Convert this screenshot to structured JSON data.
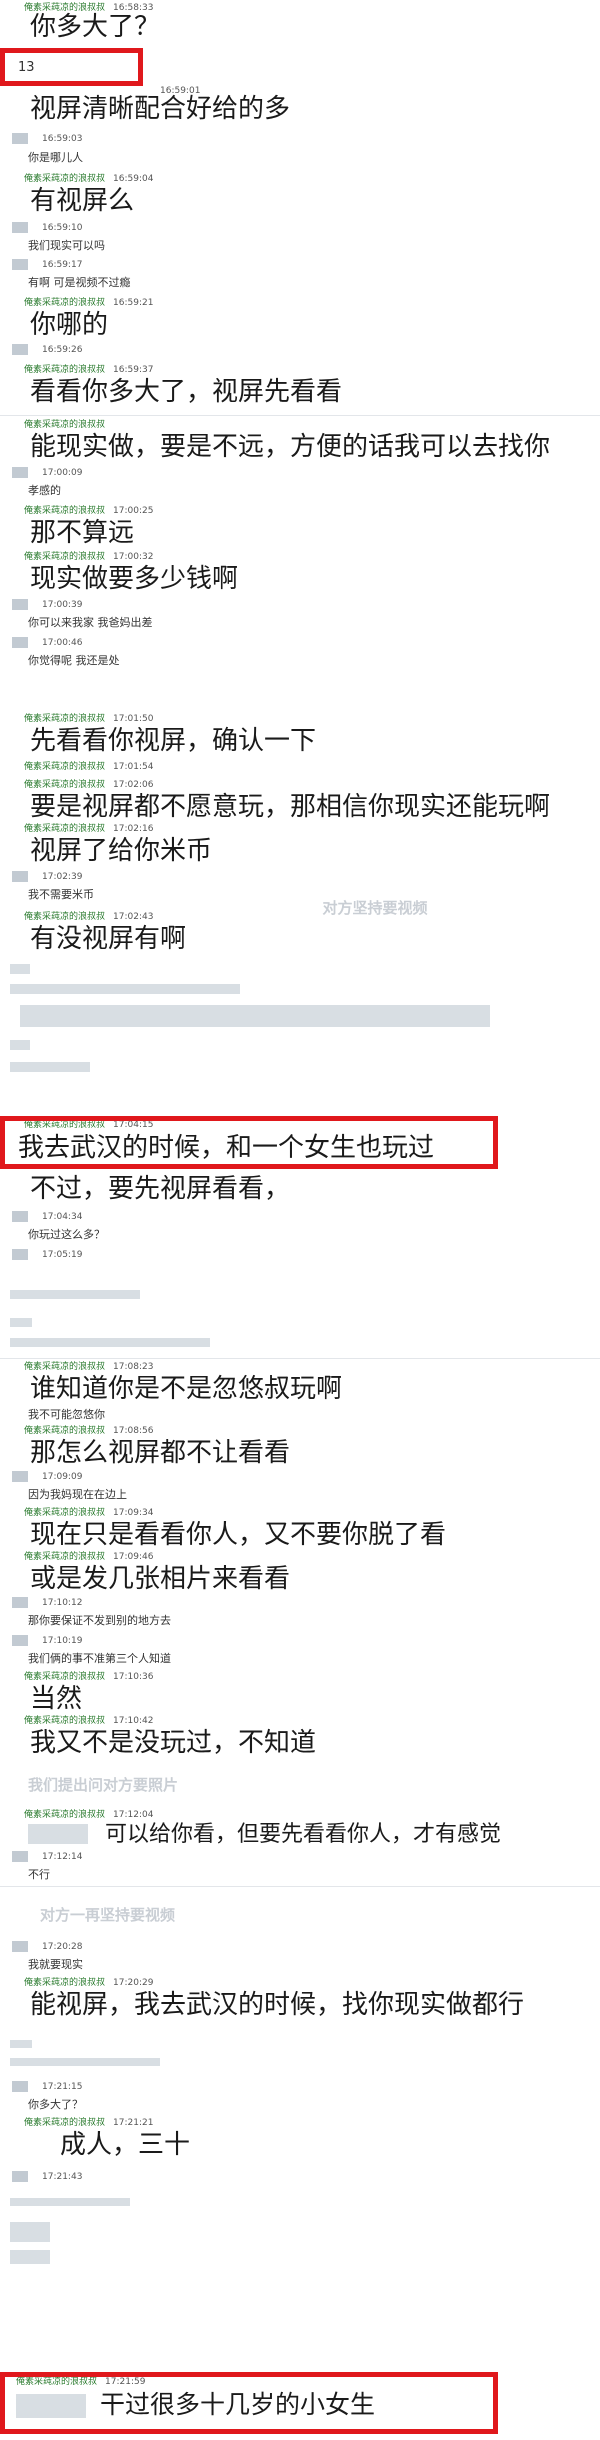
{
  "chat": {
    "sender_name": "俺素采莼凉的浪叔叔",
    "messages": [
      {
        "time": "16:58:33",
        "text": "你多大了？",
        "style": "big",
        "from": "other"
      },
      {
        "time": "",
        "text": "13",
        "style": "small",
        "from": "girl"
      },
      {
        "time": "16:59:01",
        "text": "视屏清晰配合好给的多",
        "style": "big",
        "from": "other"
      },
      {
        "time": "16:59:03",
        "text": "你是哪儿人",
        "style": "small",
        "from": "girl"
      },
      {
        "time": "16:59:04",
        "text": "有视屏么",
        "style": "big",
        "from": "other"
      },
      {
        "time": "16:59:10",
        "text": "我们现实可以吗",
        "style": "small",
        "from": "girl"
      },
      {
        "time": "16:59:17",
        "text": "有啊 可是视频不过瘾",
        "style": "small",
        "from": "girl"
      },
      {
        "time": "16:59:21",
        "text": "你哪的",
        "style": "big",
        "from": "other"
      },
      {
        "time": "16:59:26",
        "text": "",
        "style": "none",
        "from": "girl"
      },
      {
        "time": "16:59:37",
        "text": "看看你多大了，视屏先看看",
        "style": "big",
        "from": "other"
      },
      {
        "time": "",
        "text": "能现实做，要是不远，方便的话我可以去找你",
        "style": "big",
        "from": "other"
      },
      {
        "time": "17:00:09",
        "text": "孝感的",
        "style": "small",
        "from": "girl"
      },
      {
        "time": "17:00:25",
        "text": "那不算远",
        "style": "big",
        "from": "other"
      },
      {
        "time": "17:00:32",
        "text": "现实做要多少钱啊",
        "style": "big",
        "from": "other"
      },
      {
        "time": "17:00:39",
        "text": "你可以来我家 我爸妈出差",
        "style": "small",
        "from": "girl"
      },
      {
        "time": "17:00:46",
        "text": "你觉得呢 我还是处",
        "style": "small",
        "from": "girl"
      },
      {
        "time": "17:01:50",
        "text": "先看看你视屏，确认一下",
        "style": "big",
        "from": "other"
      },
      {
        "time": "17:01:54",
        "text": "",
        "style": "none",
        "from": "other"
      },
      {
        "time": "17:02:06",
        "text": "要是视屏都不愿意玩，那相信你现实还能玩啊",
        "style": "big",
        "from": "other"
      },
      {
        "time": "17:02:16",
        "text": "视屏了给你米币",
        "style": "big",
        "from": "other"
      },
      {
        "time": "17:02:39",
        "text": "我不需要米币",
        "style": "small",
        "from": "girl"
      },
      {
        "time": "17:02:43",
        "text": "有没视屏有啊",
        "style": "big",
        "from": "other"
      },
      {
        "time": "17:04:15",
        "text": "我去武汉的时候，和一个女生也玩过",
        "style": "big",
        "from": "other"
      },
      {
        "time": "",
        "text": "不过，要先视屏看看，",
        "style": "big",
        "from": "other"
      },
      {
        "time": "17:04:34",
        "text": "你玩过这么多？",
        "style": "small",
        "from": "girl"
      },
      {
        "time": "17:05:19",
        "text": "",
        "style": "none",
        "from": "girl"
      },
      {
        "time": "17:08:23",
        "text": "谁知道你是不是忽悠叔玩啊",
        "style": "big",
        "from": "other"
      },
      {
        "time": "",
        "text": "我不可能忽悠你",
        "style": "small",
        "from": "girl"
      },
      {
        "time": "17:08:56",
        "text": "那怎么视屏都不让看看",
        "style": "big",
        "from": "other"
      },
      {
        "time": "17:09:09",
        "text": "因为我妈现在在边上",
        "style": "small",
        "from": "girl"
      },
      {
        "time": "17:09:34",
        "text": "现在只是看看你人，又不要你脱了看",
        "style": "big",
        "from": "other"
      },
      {
        "time": "17:09:46",
        "text": "或是发几张相片来看看",
        "style": "big",
        "from": "other"
      },
      {
        "time": "17:10:12",
        "text": "那你要保证不发到别的地方去",
        "style": "small",
        "from": "girl"
      },
      {
        "time": "17:10:19",
        "text": "我们俩的事不准第三个人知道",
        "style": "small",
        "from": "girl"
      },
      {
        "time": "17:10:36",
        "text": "当然",
        "style": "big",
        "from": "other"
      },
      {
        "time": "17:10:42",
        "text": "我又不是没玩过，不知道",
        "style": "big",
        "from": "other"
      },
      {
        "time": "17:12:04",
        "text": "可以给你看，但要先看看你人，才有感觉",
        "style": "big",
        "from": "other"
      },
      {
        "time": "17:12:14",
        "text": "不行",
        "style": "small",
        "from": "girl"
      },
      {
        "time": "17:20:28",
        "text": "我就要现实",
        "style": "small",
        "from": "girl"
      },
      {
        "time": "17:20:29",
        "text": "能视屏，我去武汉的时候，找你现实做都行",
        "style": "big",
        "from": "other"
      },
      {
        "time": "17:21:15",
        "text": "你多大了？",
        "style": "small",
        "from": "girl"
      },
      {
        "time": "17:21:21",
        "text": "成人，三十",
        "style": "big",
        "from": "other"
      },
      {
        "time": "17:21:43",
        "text": "",
        "style": "none",
        "from": "girl"
      },
      {
        "time": "17:21:59",
        "text": "干过很多十几岁的小女生",
        "style": "big",
        "from": "other"
      }
    ]
  },
  "annotations": {
    "video_insist": "对方坚持要视频",
    "asked_photo": "我们提出问对方要照片",
    "video_insist_again": "对方一再坚持要视频"
  },
  "colors": {
    "highlight_border": "#e0181c",
    "sender_name": "#2e7d32",
    "annotation_text": "#c9ced4"
  }
}
